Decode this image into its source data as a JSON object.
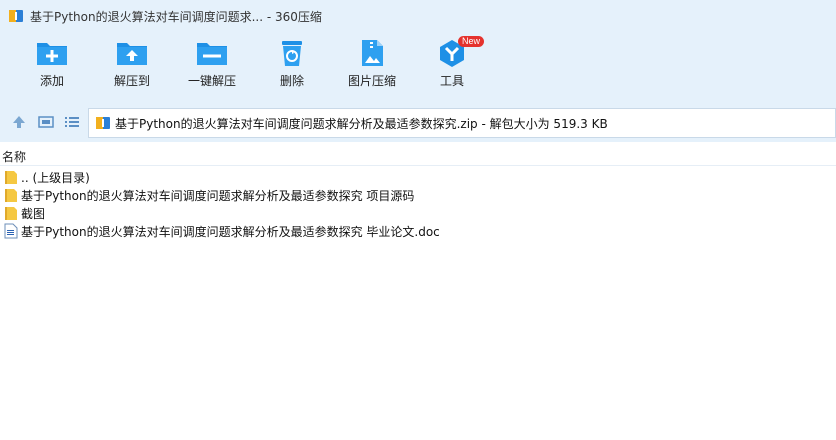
{
  "window": {
    "title": "基于Python的退火算法对车间调度问题求... - 360压缩"
  },
  "toolbar": {
    "items": [
      {
        "label": "添加",
        "icon": "add-icon"
      },
      {
        "label": "解压到",
        "icon": "extract-to-icon"
      },
      {
        "label": "一键解压",
        "icon": "one-click-extract-icon"
      },
      {
        "label": "删除",
        "icon": "delete-icon"
      },
      {
        "label": "图片压缩",
        "icon": "image-compress-icon"
      },
      {
        "label": "工具",
        "icon": "tools-icon",
        "badge": "New"
      }
    ]
  },
  "address": {
    "path": "基于Python的退火算法对车间调度问题求解分析及最适参数探究.zip - 解包大小为 519.3 KB"
  },
  "list": {
    "column_name": "名称",
    "files": [
      {
        "name": ".. (上级目录)",
        "type": "folder"
      },
      {
        "name": "基于Python的退火算法对车间调度问题求解分析及最适参数探究 项目源码",
        "type": "folder"
      },
      {
        "name": "截图",
        "type": "folder"
      },
      {
        "name": "基于Python的退火算法对车间调度问题求解分析及最适参数探究 毕业论文.doc",
        "type": "doc"
      }
    ]
  },
  "colors": {
    "chrome_bg": "#e5f1fb",
    "icon_blue": "#1e90e6",
    "folder_yellow": "#f5c842",
    "badge_red": "#e5322d"
  }
}
